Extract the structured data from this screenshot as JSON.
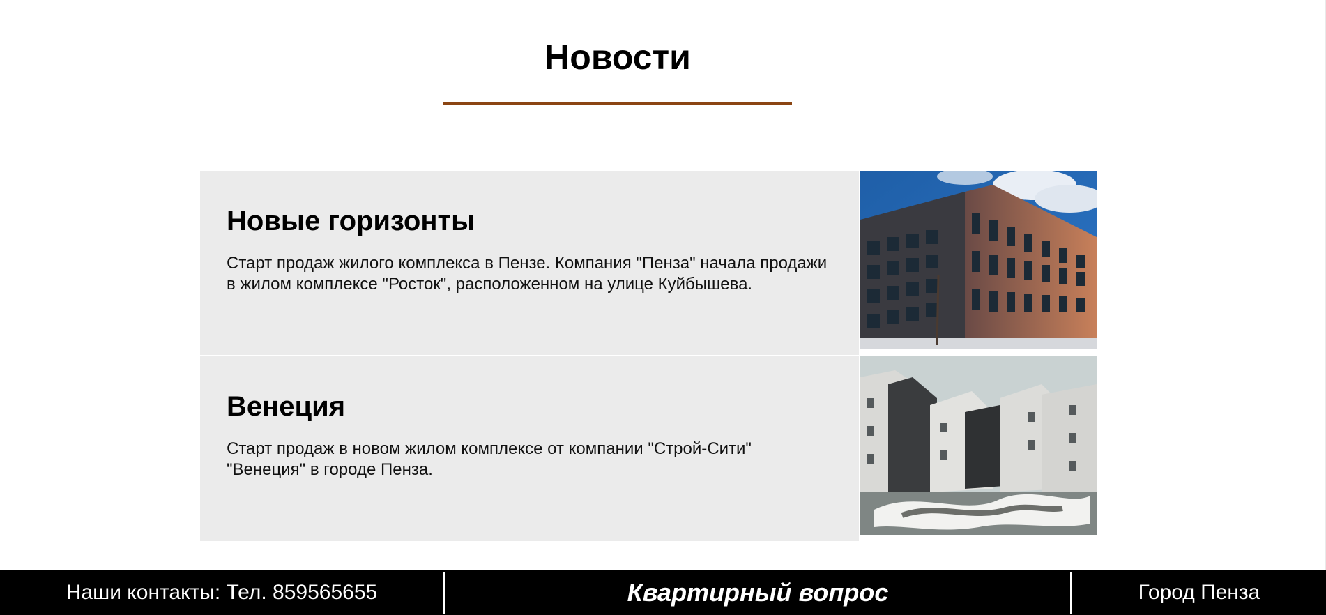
{
  "section": {
    "title": "Новости",
    "accent_color": "#8b4513"
  },
  "news": [
    {
      "heading": "Новые горизонты",
      "body": "Старт продаж жилого комплекса в Пензе. Компания \"Пенза\" начала продажи в жилом комплексе \"Росток\", расположенном на улице Куйбышева."
    },
    {
      "heading": "Венеция",
      "body": "Старт продаж в новом жилом комплексе от компании \"Строй-Сити\" \"Венеция\" в городе Пенза."
    }
  ],
  "footer": {
    "contacts": "Наши контакты: Тел. 859565655",
    "brand": "Квартирный вопрос",
    "city": "Город Пенза"
  }
}
